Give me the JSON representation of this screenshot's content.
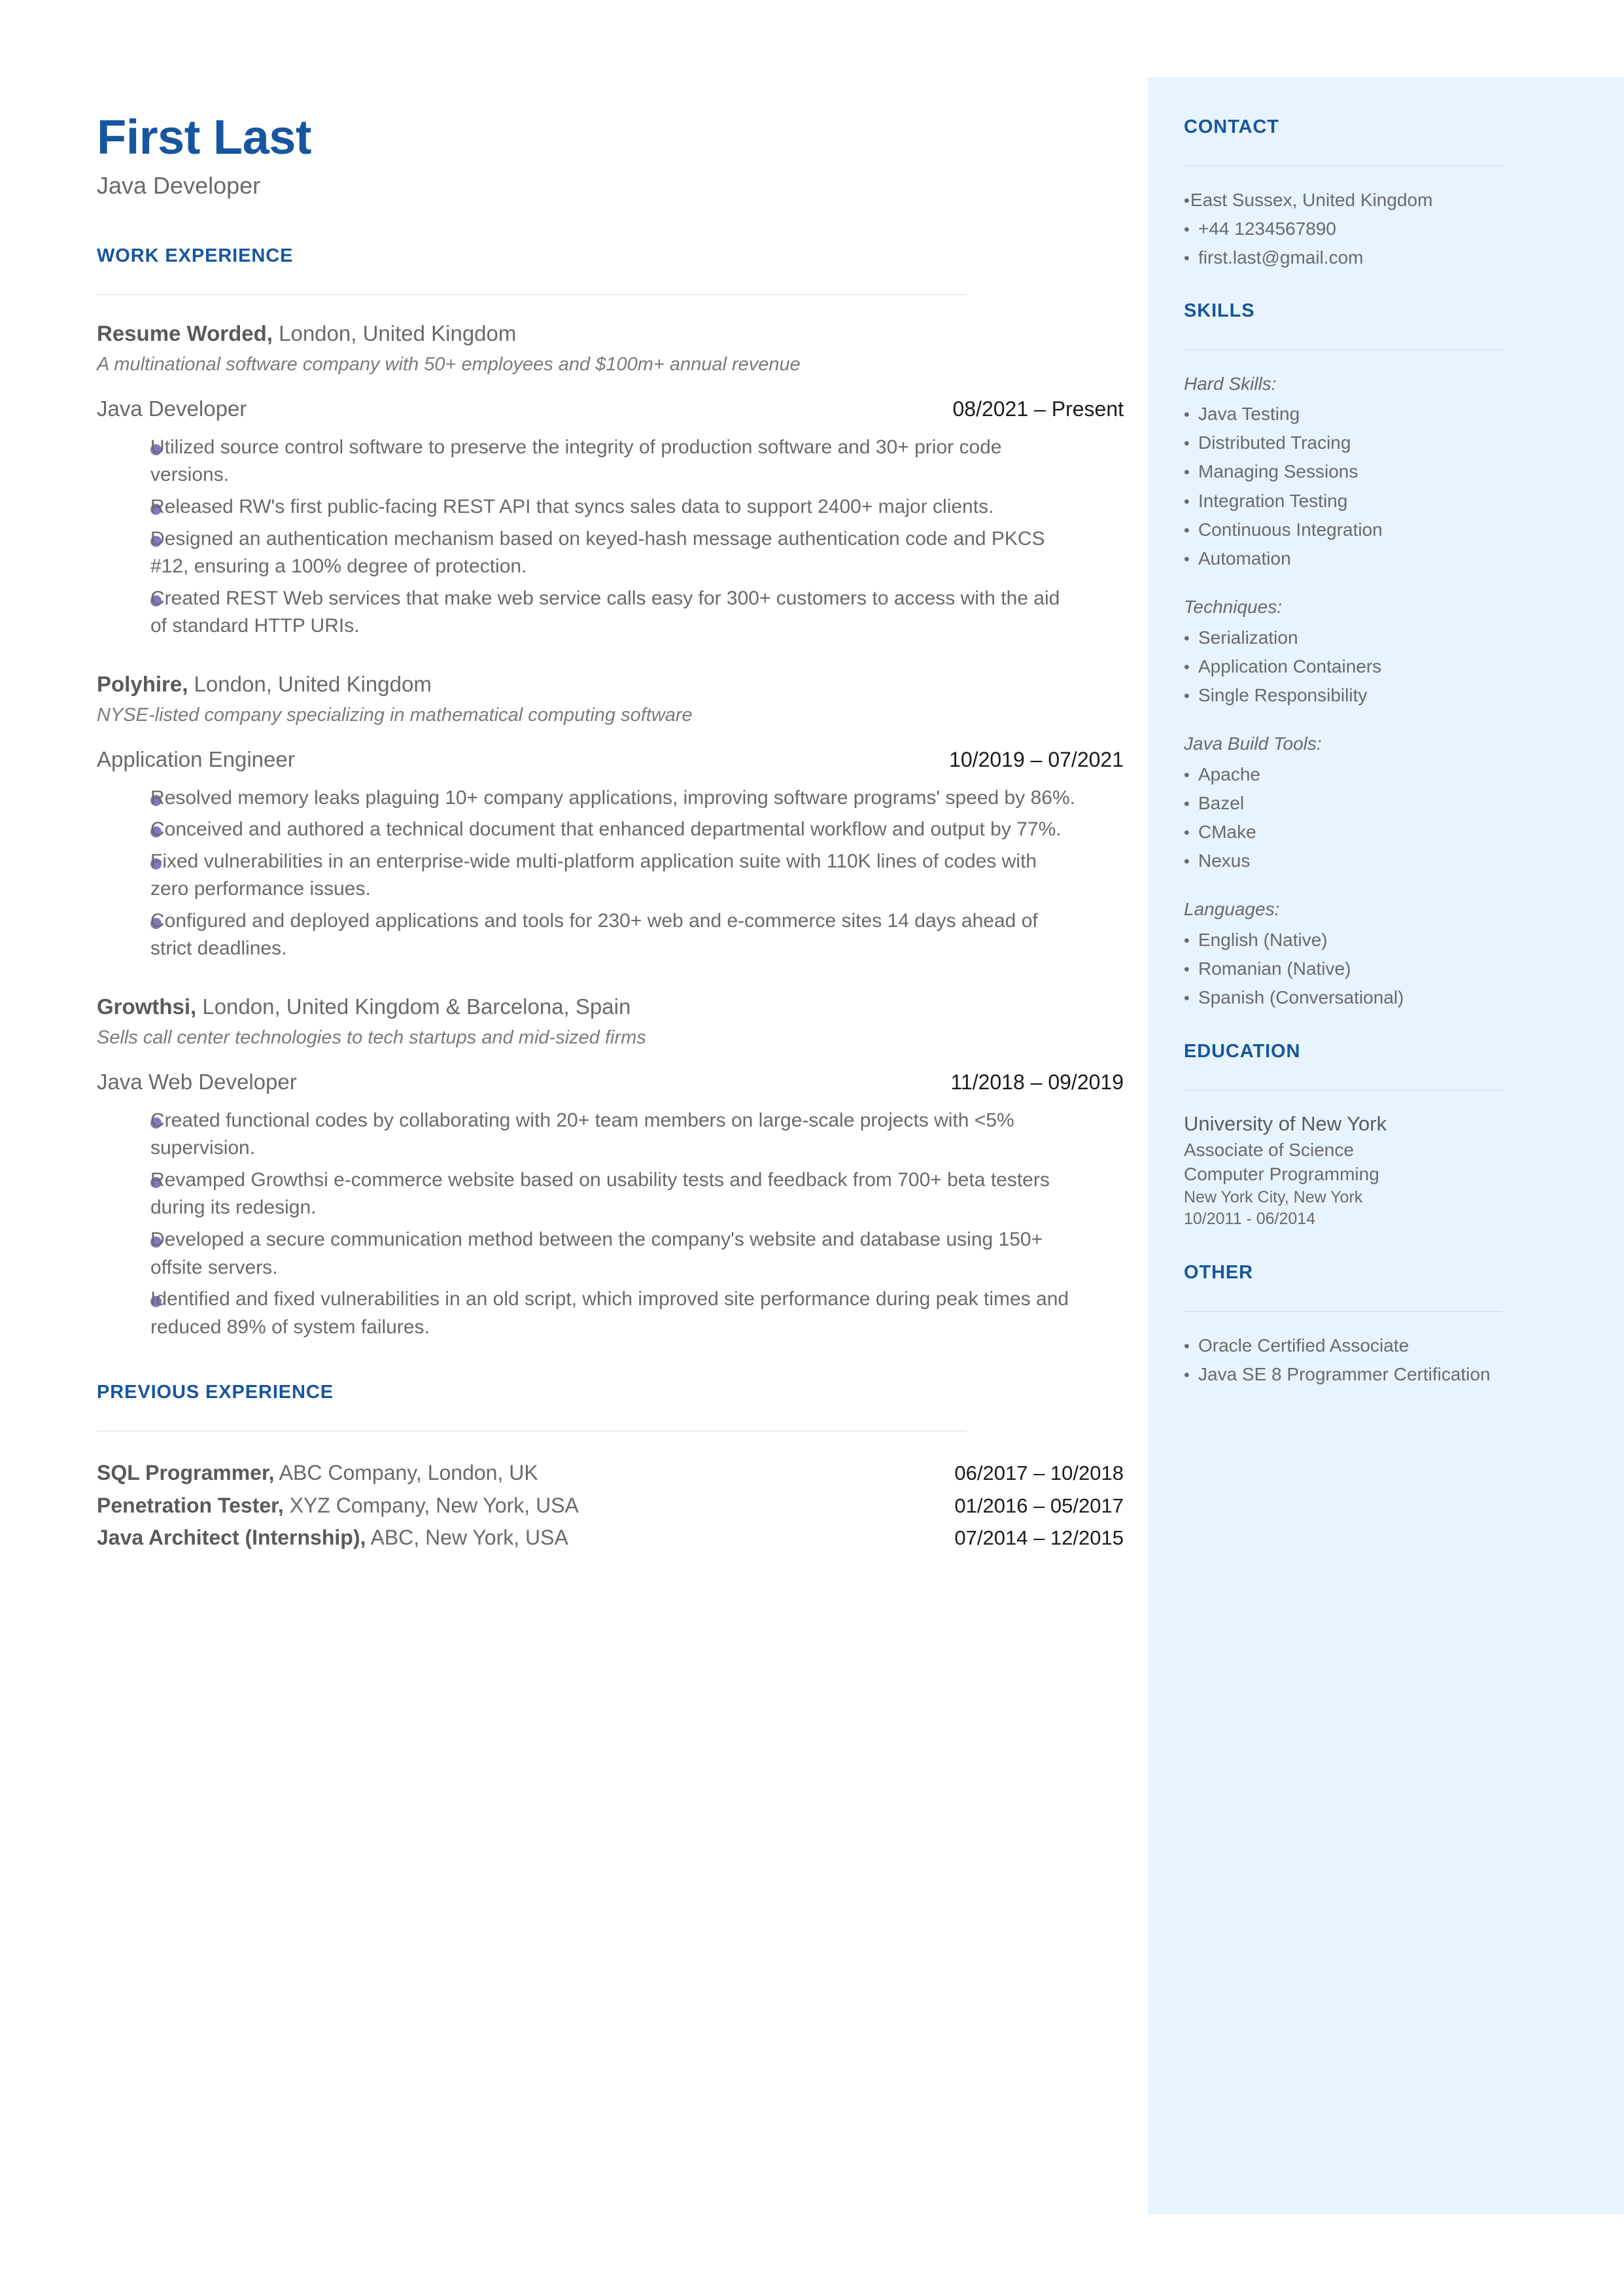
{
  "header": {
    "name": "First Last",
    "role": "Java Developer"
  },
  "colors": {
    "accent": "#17569e",
    "sidebar_bg": "#e7f3fd",
    "bullet": "#8278bd",
    "body_text": "#6a6a6a",
    "date_text": "#1b1b1b"
  },
  "main": {
    "work_experience_heading": "WORK EXPERIENCE",
    "previous_experience_heading": "PREVIOUS EXPERIENCE",
    "jobs": [
      {
        "company": "Resume Worded,",
        "location": " London, United Kingdom",
        "description": "A multinational software company with 50+ employees and $100m+ annual revenue",
        "title": "Java Developer",
        "dates": "08/2021 – Present",
        "bullets": [
          "Utilized source control software to preserve the integrity of production software and 30+ prior code versions.",
          "Released RW's first public-facing REST API that syncs sales data to support 2400+ major clients.",
          "Designed an authentication mechanism based on keyed-hash message authentication code and PKCS #12, ensuring a 100% degree of protection.",
          "Created REST Web services that make web service calls easy for 300+ customers to access with the aid of standard HTTP URIs."
        ]
      },
      {
        "company": "Polyhire,",
        "location": " London, United Kingdom",
        "description": "NYSE-listed company specializing in mathematical computing software",
        "title": "Application Engineer",
        "dates": "10/2019 – 07/2021",
        "bullets": [
          "Resolved memory leaks plaguing 10+ company applications, improving software programs' speed by 86%.",
          "Conceived and authored a technical document that enhanced departmental workflow and output by 77%.",
          "Fixed vulnerabilities in an enterprise-wide multi-platform application suite with 110K lines of codes with zero performance issues.",
          "Configured and deployed applications and tools for 230+ web and e-commerce sites 14 days ahead of strict deadlines."
        ]
      },
      {
        "company": "Growthsi,",
        "location": " London, United Kingdom & Barcelona, Spain",
        "description": "Sells call center technologies to tech startups and mid-sized firms",
        "title": "Java Web Developer",
        "dates": "11/2018 – 09/2019",
        "bullets": [
          "Created functional codes by collaborating with 20+ team members on large-scale projects with <5% supervision.",
          "Revamped Growthsi e-commerce website based on usability tests and feedback from 700+ beta testers during its redesign.",
          "Developed a secure communication method between the company's website and database using 150+ offsite servers.",
          "Identified and fixed vulnerabilities in an old script, which improved site performance during peak times and reduced 89% of system failures."
        ]
      }
    ],
    "previous_experience": [
      {
        "title": "SQL Programmer,",
        "detail": " ABC Company, London, UK",
        "dates": "06/2017 – 10/2018"
      },
      {
        "title": "Penetration Tester,",
        "detail": " XYZ Company, New York, USA",
        "dates": "01/2016 – 05/2017"
      },
      {
        "title": "Java Architect (Internship),",
        "detail": " ABC, New York, USA",
        "dates": "07/2014 – 12/2015"
      }
    ]
  },
  "sidebar": {
    "contact": {
      "heading": "CONTACT",
      "items": [
        "East Sussex, United Kingdom",
        "+44 1234567890",
        "first.last@gmail.com"
      ]
    },
    "skills": {
      "heading": "SKILLS",
      "groups": [
        {
          "label": "Hard Skills:",
          "items": [
            "Java Testing",
            "Distributed Tracing",
            "Managing Sessions",
            "Integration Testing",
            "Continuous Integration",
            "Automation"
          ]
        },
        {
          "label": "Techniques:",
          "items": [
            "Serialization",
            "Application Containers",
            "Single Responsibility"
          ]
        },
        {
          "label": "Java Build Tools:",
          "items": [
            "Apache",
            "Bazel",
            "CMake",
            "Nexus"
          ]
        },
        {
          "label": "Languages:",
          "items": [
            "English (Native)",
            "Romanian (Native)",
            "Spanish (Conversational)"
          ]
        }
      ]
    },
    "education": {
      "heading": "EDUCATION",
      "school": "University of New York",
      "degree": "Associate of Science",
      "field": "Computer Programming",
      "location": "New York City, New York",
      "dates": "10/2011 - 06/2014"
    },
    "other": {
      "heading": "OTHER",
      "items": [
        "Oracle Certified Associate",
        "Java SE 8 Programmer Certification"
      ]
    }
  },
  "icons": {
    "bullet_dot": "bullet-dot-icon",
    "list_dot": "list-dot-icon"
  }
}
